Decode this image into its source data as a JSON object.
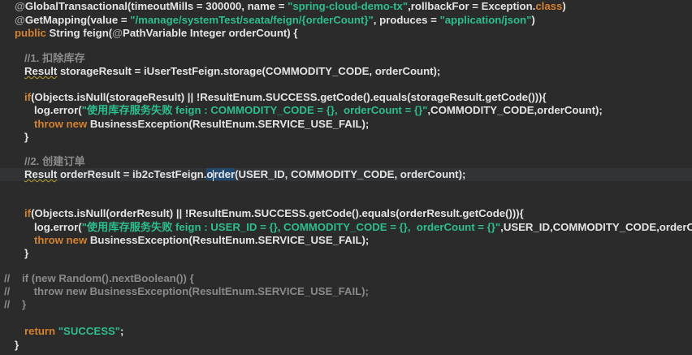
{
  "editor": {
    "colors": {
      "background": "#2b2b2b",
      "text": "#e4e4e4",
      "keyword": "#d4822e",
      "string": "#2dbd8f",
      "comment": "#8a8a8a",
      "selection": "#214a72"
    },
    "lines": [
      {
        "indent": 1,
        "segs": [
          [
            "ann",
            "@"
          ],
          [
            "",
            "GlobalTransactional(timeoutMills = 300000, name = "
          ],
          [
            "str",
            "\"spring-cloud-demo-tx\""
          ],
          [
            "",
            ",rollbackFor = Exception."
          ],
          [
            "kw",
            "class"
          ],
          [
            "",
            ")"
          ]
        ]
      },
      {
        "indent": 1,
        "segs": [
          [
            "ann",
            "@"
          ],
          [
            "",
            "GetMapping(value = "
          ],
          [
            "str",
            "\"/manage/systemTest/seata/feign/{orderCount}\""
          ],
          [
            "",
            ", produces = "
          ],
          [
            "str",
            "\"application/json\""
          ],
          [
            "",
            ")"
          ]
        ]
      },
      {
        "indent": 1,
        "segs": [
          [
            "kw",
            "public"
          ],
          [
            "",
            " String feign("
          ],
          [
            "ann",
            "@"
          ],
          [
            "",
            "PathVariable Integer orderCount) {"
          ]
        ]
      },
      {
        "indent": 2,
        "segs": [
          [
            "cm",
            "//1. 扣除库存"
          ]
        ]
      },
      {
        "indent": 2,
        "segs": [
          [
            "warn",
            "Result"
          ],
          [
            "",
            " storageResult = iUserTestFeign.storage(COMMODITY_CODE, orderCount);"
          ]
        ]
      },
      {
        "indent": 2,
        "segs": [
          [
            "kw",
            "if"
          ],
          [
            "",
            "(Objects.isNull(storageResult) || !ResultEnum.SUCCESS.getCode().equals(storageResult.getCode())){"
          ]
        ]
      },
      {
        "indent": 3,
        "segs": [
          [
            "",
            "log.error("
          ],
          [
            "str",
            "\"使用库存服务失败 feign : COMMODITY_CODE = {},  orderCount = {}\""
          ],
          [
            "",
            ",COMMODITY_CODE,orderCount);"
          ]
        ]
      },
      {
        "indent": 3,
        "segs": [
          [
            "kw",
            "throw new"
          ],
          [
            "",
            " BusinessException(ResultEnum.SERVICE_USE_FAIL);"
          ]
        ]
      },
      {
        "indent": 2,
        "segs": [
          [
            "",
            "}"
          ]
        ]
      },
      {
        "indent": 2,
        "segs": [
          [
            "cm",
            "//2. 创建订单"
          ]
        ]
      },
      {
        "indent": 2,
        "current": true,
        "segs": [
          [
            "warn",
            "Result"
          ],
          [
            "",
            " orderResult = ib2cTestFeign."
          ],
          [
            "sel",
            "o"
          ],
          [
            "caret",
            ""
          ],
          [
            "sel",
            "rder"
          ],
          [
            "",
            "(USER_ID, COMMODITY_CODE, orderCount);"
          ]
        ]
      },
      {
        "indent": 2,
        "segs": [
          [
            "kw",
            "if"
          ],
          [
            "",
            "(Objects.isNull(orderResult) || !ResultEnum.SUCCESS.getCode().equals(orderResult.getCode())){"
          ]
        ]
      },
      {
        "indent": 3,
        "segs": [
          [
            "",
            "log.error("
          ],
          [
            "str",
            "\"使用库存服务失败 feign : USER_ID = {}, COMMODITY_CODE = {},  orderCount = {}\""
          ],
          [
            "",
            ",USER_ID,COMMODITY_CODE,orderCount);"
          ]
        ]
      },
      {
        "indent": 3,
        "segs": [
          [
            "kw",
            "throw new"
          ],
          [
            "",
            " BusinessException(ResultEnum.SERVICE_USE_FAIL);"
          ]
        ]
      },
      {
        "indent": 2,
        "segs": [
          [
            "",
            "}"
          ]
        ]
      },
      {
        "indent": 0,
        "segs": [
          [
            "cm",
            "//    if (new Random().nextBoolean()) {"
          ]
        ]
      },
      {
        "indent": 0,
        "segs": [
          [
            "cm",
            "//        throw new BusinessException(ResultEnum.SERVICE_USE_FAIL);"
          ]
        ]
      },
      {
        "indent": 0,
        "segs": [
          [
            "cm",
            "//    }"
          ]
        ]
      },
      {
        "indent": 2,
        "segs": [
          [
            "kw",
            "return"
          ],
          [
            "",
            " "
          ],
          [
            "str",
            "\"SUCCESS\""
          ],
          [
            "",
            ";"
          ]
        ]
      },
      {
        "indent": 1,
        "segs": [
          [
            "",
            "}"
          ]
        ]
      }
    ]
  }
}
